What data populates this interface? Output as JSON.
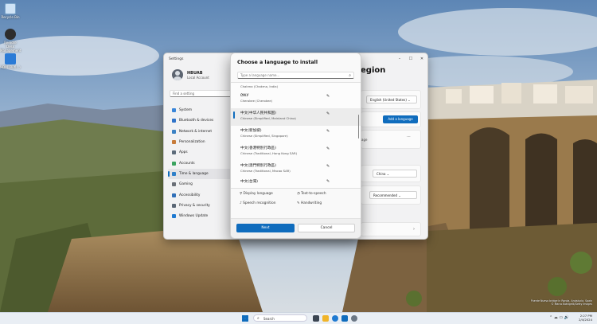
{
  "desktop": {
    "icons": [
      {
        "label": "Recycle Bin",
        "icon": "recycle-bin-icon"
      },
      {
        "label": "Remote Desk Management",
        "icon": "remote-desktop-icon"
      },
      {
        "label": "HDM (Rufl...)",
        "icon": "app-shortcut-icon"
      }
    ]
  },
  "settings": {
    "title": "Settings",
    "window_buttons": [
      "–",
      "☐",
      "✕"
    ],
    "user_name": "HBUAB",
    "user_type": "Local Account",
    "find_placeholder": "Find a setting",
    "nav": [
      {
        "label": "System",
        "color": "#3a86d9"
      },
      {
        "label": "Bluetooth & devices",
        "color": "#2f73c9"
      },
      {
        "label": "Network & internet",
        "color": "#3b82c4"
      },
      {
        "label": "Personalization",
        "color": "#c77b3a"
      },
      {
        "label": "Apps",
        "color": "#5c6b7a"
      },
      {
        "label": "Accounts",
        "color": "#3aa35f"
      },
      {
        "label": "Time & language",
        "color": "#2f80c9",
        "active": true
      },
      {
        "label": "Gaming",
        "color": "#6a6f77"
      },
      {
        "label": "Accessibility",
        "color": "#2f6fb8"
      },
      {
        "label": "Privacy & security",
        "color": "#5a6675"
      },
      {
        "label": "Windows Update",
        "color": "#1f7ad1"
      }
    ],
    "pane_title": "egion",
    "display_language": "English (United States)",
    "add_language_label": "Add a language",
    "ellipsis": "···",
    "ling_text": "age",
    "country": "China",
    "regional_format": "Recommended",
    "chevron": "›"
  },
  "dialog": {
    "title": "Choose a language to install",
    "search_placeholder": "Type a language name...",
    "search_icon": "⌕",
    "languages": [
      {
        "native": "",
        "english": "Chakma (Chakma, India)",
        "pen": false
      },
      {
        "native": "ᏣᎳᎩ",
        "english": "Cherokee (Cherokee)",
        "pen": true
      },
      {
        "native": "中文(中华人民共和国)",
        "english": "Chinese (Simplified, Mainland China)",
        "pen": true,
        "selected": true
      },
      {
        "native": "中文(新加坡)",
        "english": "Chinese (Simplified, Singapore)",
        "pen": true
      },
      {
        "native": "中文(香港特別行政區)",
        "english": "Chinese (Traditional, Hong Kong SAR)",
        "pen": true
      },
      {
        "native": "中文(澳門特別行政區)",
        "english": "Chinese (Traditional, Macao SAR)",
        "pen": true
      },
      {
        "native": "中文(台灣)",
        "english": "",
        "pen": true
      }
    ],
    "pen_glyph": "✎",
    "legend": {
      "display_language": "Display language",
      "text_to_speech": "Text-to-speech",
      "speech_recognition": "Speech recognition",
      "handwriting": "Handwriting"
    },
    "next_label": "Next",
    "cancel_label": "Cancel"
  },
  "taskbar": {
    "search_label": "Search",
    "time": "2:27 PM",
    "date": "2/4/2024",
    "tray_icons": "⌃ ☁ ▭ 🔊"
  },
  "watermark": {
    "line1": "Puente Nuevo bridge in Ronda, Andalucía, Spain",
    "line2": "© Marco Bottigelli/Getty Images"
  }
}
